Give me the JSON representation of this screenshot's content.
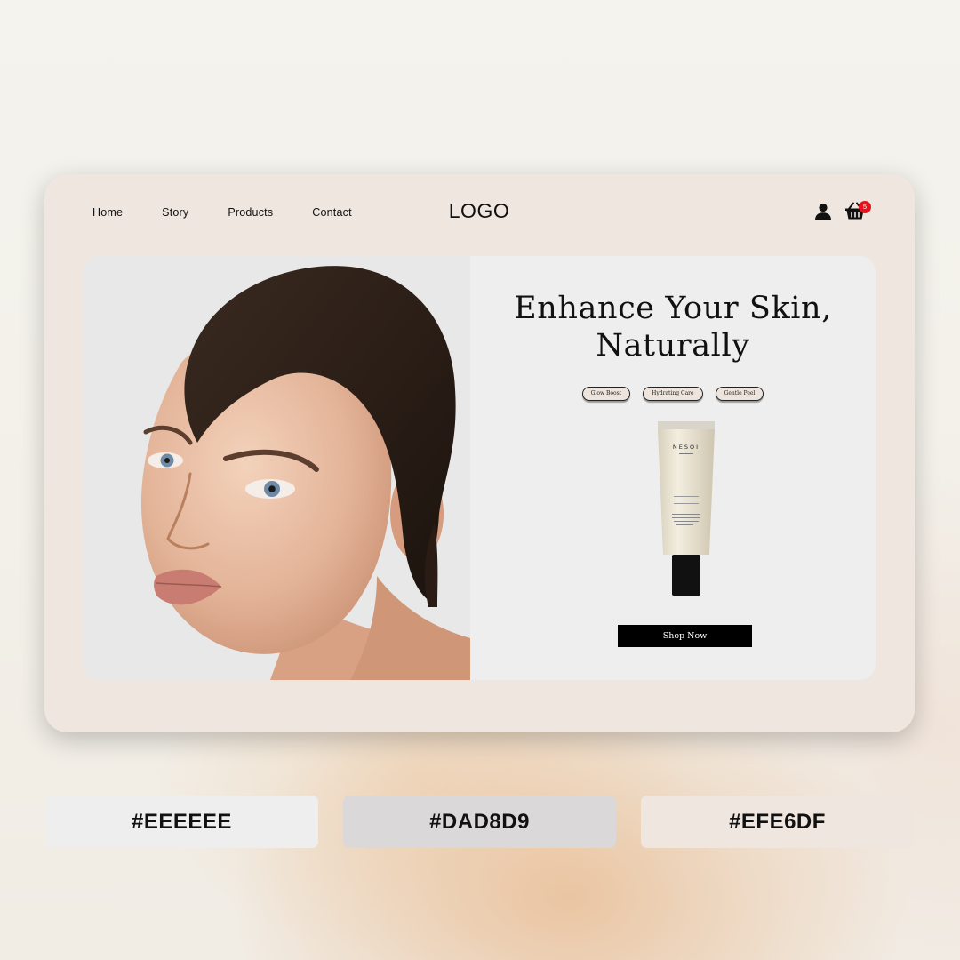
{
  "nav": {
    "items": [
      "Home",
      "Story",
      "Products",
      "Contact"
    ]
  },
  "logo": "LOGO",
  "header": {
    "user_icon": "user-icon",
    "cart_icon": "basket-icon",
    "cart_count": "5",
    "badge_color": "#E3141B"
  },
  "hero": {
    "headline_line1": "Enhance Your Skin,",
    "headline_line2": "Naturally",
    "tags": [
      "Glow Boost",
      "Hydrating Care",
      "Gentle Peel"
    ],
    "product_brand": "NESOI",
    "cta_label": "Shop Now"
  },
  "palette": [
    {
      "label": "#EEEEEE",
      "color": "#EEEEEE"
    },
    {
      "label": "#DAD8D9",
      "color": "#DAD8D9"
    },
    {
      "label": "#EFE6DF",
      "color": "#EFE6DF"
    }
  ]
}
